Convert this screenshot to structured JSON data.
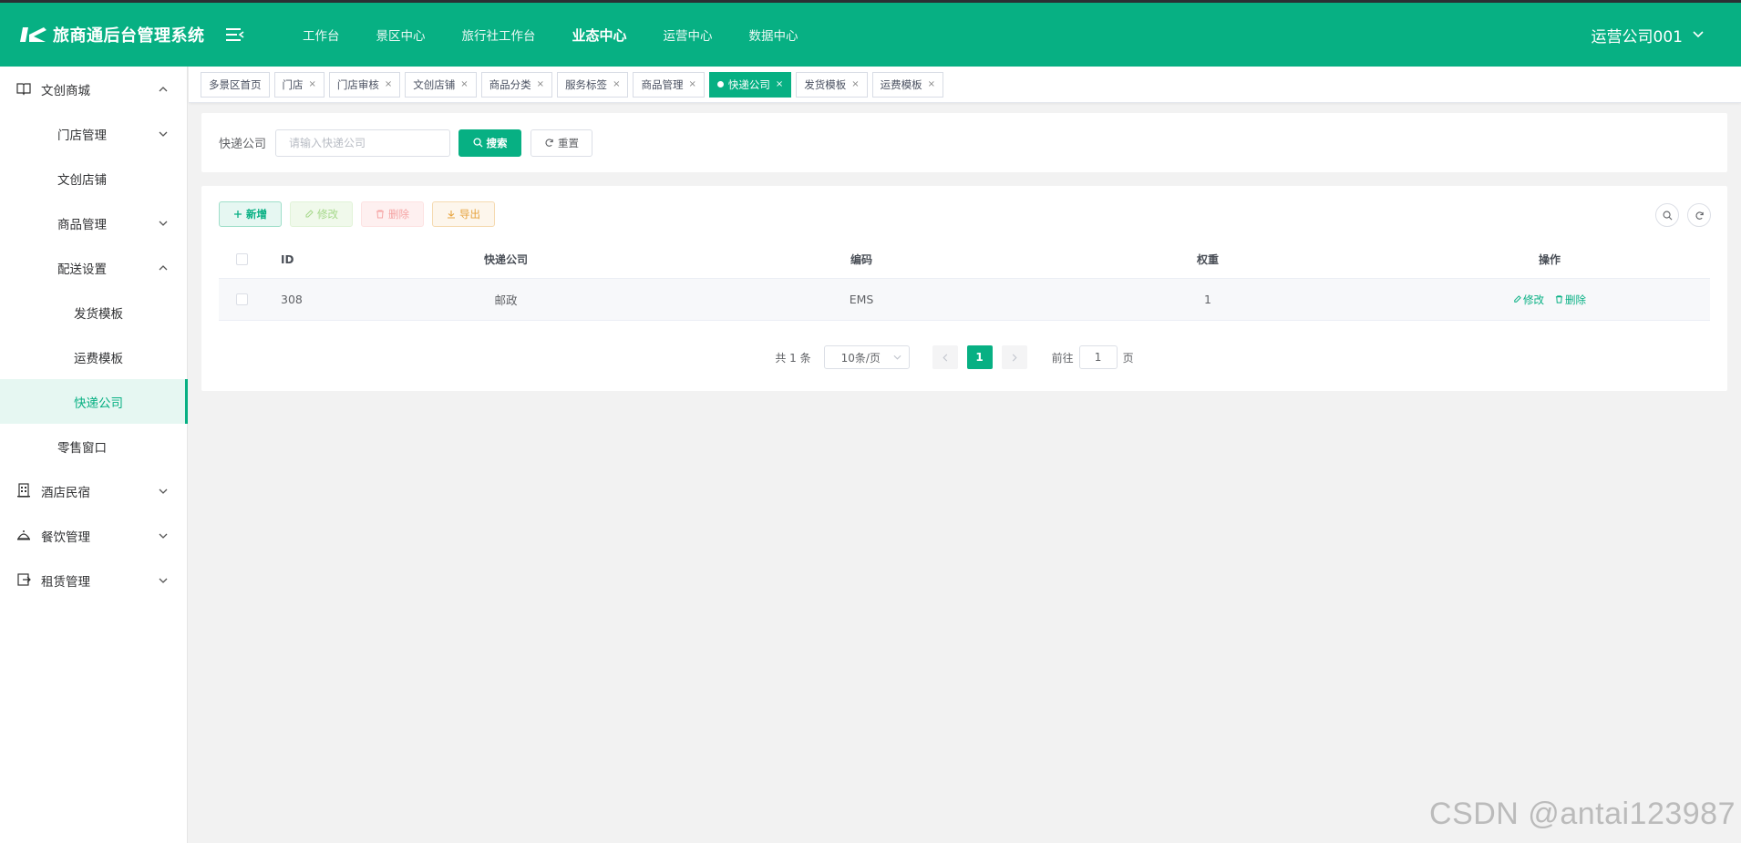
{
  "app": {
    "title": "旅商通后台管理系统"
  },
  "topnav": {
    "items": [
      "工作台",
      "景区中心",
      "旅行社工作台",
      "业态中心",
      "运营中心",
      "数据中心"
    ],
    "active_index": 3
  },
  "user": {
    "name": "运营公司001"
  },
  "sidebar": {
    "items": [
      {
        "label": "文创商城",
        "icon": "book-icon",
        "expanded": true
      },
      {
        "label": "门店管理",
        "expanded": false
      },
      {
        "label": "文创店铺"
      },
      {
        "label": "商品管理",
        "expanded": false
      },
      {
        "label": "配送设置",
        "expanded": true
      },
      {
        "label": "发货模板"
      },
      {
        "label": "运费模板"
      },
      {
        "label": "快递公司",
        "active": true
      },
      {
        "label": "零售窗口"
      },
      {
        "label": "酒店民宿",
        "icon": "building-icon",
        "expanded": false
      },
      {
        "label": "餐饮管理",
        "icon": "dining-icon",
        "expanded": false
      },
      {
        "label": "租赁管理",
        "icon": "rental-icon",
        "expanded": false
      }
    ]
  },
  "tags": [
    {
      "label": "多景区首页",
      "closable": false
    },
    {
      "label": "门店",
      "closable": true
    },
    {
      "label": "门店审核",
      "closable": true
    },
    {
      "label": "文创店铺",
      "closable": true
    },
    {
      "label": "商品分类",
      "closable": true
    },
    {
      "label": "服务标签",
      "closable": true
    },
    {
      "label": "商品管理",
      "closable": true
    },
    {
      "label": "快递公司",
      "closable": true,
      "active": true
    },
    {
      "label": "发货模板",
      "closable": true
    },
    {
      "label": "运费模板",
      "closable": true
    }
  ],
  "search": {
    "label": "快递公司",
    "placeholder": "请输入快递公司",
    "value": "",
    "search_button": "搜索",
    "reset_button": "重置"
  },
  "toolbar": {
    "add": "新增",
    "edit": "修改",
    "delete": "删除",
    "export": "导出"
  },
  "table": {
    "columns": [
      "ID",
      "快递公司",
      "编码",
      "权重",
      "操作"
    ],
    "rows": [
      {
        "id": "308",
        "company": "邮政",
        "code": "EMS",
        "weight": "1",
        "ops": [
          "修改",
          "删除"
        ]
      }
    ]
  },
  "pagination": {
    "total_text": "共 1 条",
    "page_size": "10条/页",
    "current_page": "1",
    "goto_label": "前往",
    "goto_value": "1",
    "page_unit": "页"
  },
  "watermark": "CSDN @antai123987",
  "colors": {
    "primary": "#07b083",
    "header_bg": "#07b083",
    "sidebar_active_bg": "#e6f7f2"
  }
}
